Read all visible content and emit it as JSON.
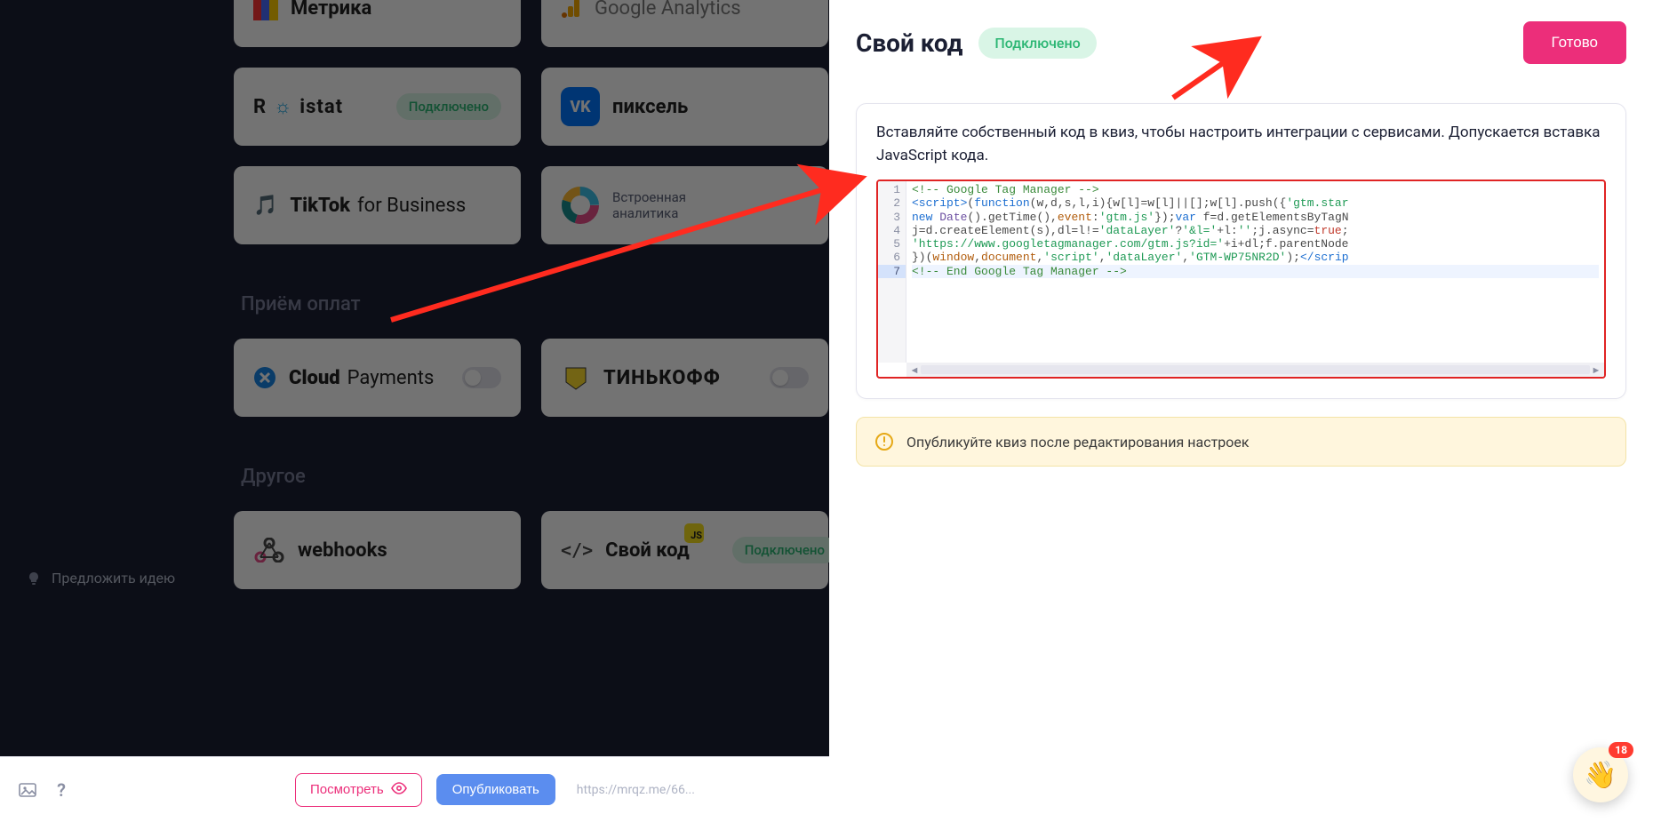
{
  "integrations": {
    "metrika": "Метрика",
    "ga": "Google Analytics",
    "roistat_name": "Roistat",
    "roistat_status": "Подключено",
    "vk_pixel": "пиксель",
    "tiktok": "TikTok",
    "tiktok_suffix": " for Business",
    "builtin_line1": "Встроенная",
    "builtin_line2": "аналитика",
    "section_payments": "Приём оплат",
    "cloudpayments_a": "Cloud",
    "cloudpayments_b": "Payments",
    "tinkoff": "ТИНЬКОФФ",
    "section_other": "Другое",
    "webhooks": "webhooks",
    "own_code": "Свой код",
    "own_code_status": "Подключено"
  },
  "suggest": "Предложить идею",
  "footer": {
    "preview": "Посмотреть",
    "publish": "Опубликовать",
    "url": "https://mrqz.me/66..."
  },
  "panel": {
    "title": "Свой код",
    "status": "Подключено",
    "done": "Готово",
    "desc": "Вставляйте собственный код в квиз, чтобы настроить интеграции с сервисами. Допускается вставка JavaScript кода.",
    "warn": "Опубликуйте квиз после редактирования настроек"
  },
  "code": {
    "lines": [
      "1",
      "2",
      "3",
      "4",
      "5",
      "6",
      "7"
    ],
    "l1_comment": "<!-- Google Tag Manager -->",
    "l2_a": "<script>",
    "l2_b": "(",
    "l2_c": "function",
    "l2_d": "(w,d,s,l,i){w[l]=w[l]||[];w[l].push({",
    "l2_e": "'gtm.star",
    "l3_a": "new ",
    "l3_b": "Date",
    "l3_c": "().getTime(),",
    "l3_d": "event",
    "l3_e": ":",
    "l3_f": "'gtm.js'",
    "l3_g": "});",
    "l3_h": "var ",
    "l3_i": "f=d.getElementsByTagN",
    "l4_a": "j=d.createElement(s),dl=l!=",
    "l4_b": "'dataLayer'",
    "l4_c": "?",
    "l4_d": "'&l='",
    "l4_e": "+l:",
    "l4_f": "''",
    "l4_g": ";j.async=",
    "l4_h": "true",
    "l4_i": ";",
    "l5_a": "'https://www.googletagmanager.com/gtm.js?id='",
    "l5_b": "+i+dl;f.parentNode",
    "l6_a": "})(",
    "l6_b": "window",
    "l6_c": ",",
    "l6_d": "document",
    "l6_e": ",",
    "l6_f": "'script'",
    "l6_g": ",",
    "l6_h": "'dataLayer'",
    "l6_i": ",",
    "l6_j": "'GTM-WP75NR2D'",
    "l6_k": ");",
    "l6_l": "</scrip",
    "l7_comment": "<!-- End Google Tag Manager -->"
  },
  "chat": {
    "badge": "18"
  }
}
